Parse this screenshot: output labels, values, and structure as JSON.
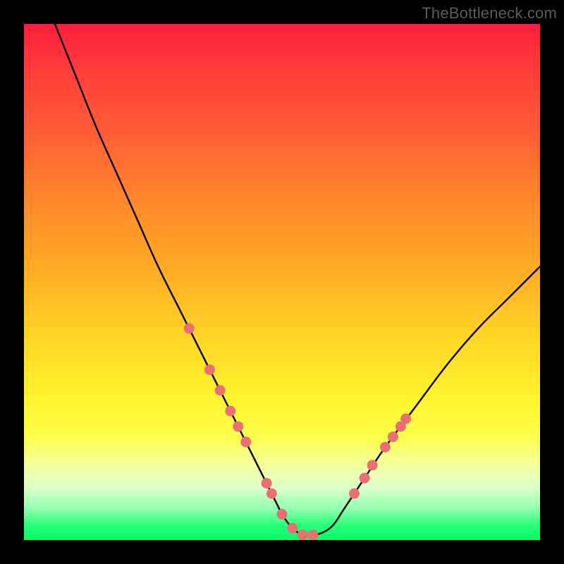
{
  "watermark": "TheBottleneck.com",
  "chart_data": {
    "type": "line",
    "title": "",
    "xlabel": "",
    "ylabel": "",
    "xlim": [
      0,
      100
    ],
    "ylim": [
      0,
      100
    ],
    "series": [
      {
        "name": "curve",
        "x": [
          6,
          10,
          14,
          18,
          22,
          26,
          30,
          32,
          34,
          36,
          38,
          40,
          42,
          44,
          46,
          48,
          49,
          50,
          51,
          52,
          53,
          54,
          56,
          58,
          60,
          62,
          66,
          70,
          76,
          82,
          88,
          94,
          100
        ],
        "values": [
          100,
          90,
          80,
          71,
          62,
          53,
          45,
          41,
          37,
          33,
          29,
          25,
          21,
          17,
          13,
          9,
          7,
          5,
          3.5,
          2.3,
          1.5,
          1,
          1,
          1.5,
          3,
          6,
          12,
          18,
          26,
          34,
          41,
          47,
          53
        ]
      }
    ],
    "markers": [
      {
        "x": 32,
        "y": 41
      },
      {
        "x": 36,
        "y": 33
      },
      {
        "x": 38,
        "y": 29
      },
      {
        "x": 40,
        "y": 25
      },
      {
        "x": 41.5,
        "y": 22
      },
      {
        "x": 43,
        "y": 19
      },
      {
        "x": 47,
        "y": 11
      },
      {
        "x": 48,
        "y": 9
      },
      {
        "x": 50,
        "y": 5
      },
      {
        "x": 52,
        "y": 2.3
      },
      {
        "x": 54,
        "y": 1
      },
      {
        "x": 56,
        "y": 1
      },
      {
        "x": 64,
        "y": 9
      },
      {
        "x": 66,
        "y": 12
      },
      {
        "x": 67.5,
        "y": 14.5
      },
      {
        "x": 70,
        "y": 18
      },
      {
        "x": 71.5,
        "y": 20
      },
      {
        "x": 73,
        "y": 22
      },
      {
        "x": 74,
        "y": 23.5
      }
    ],
    "colors": {
      "curve": "#000000",
      "markers": "#e96f72"
    }
  }
}
